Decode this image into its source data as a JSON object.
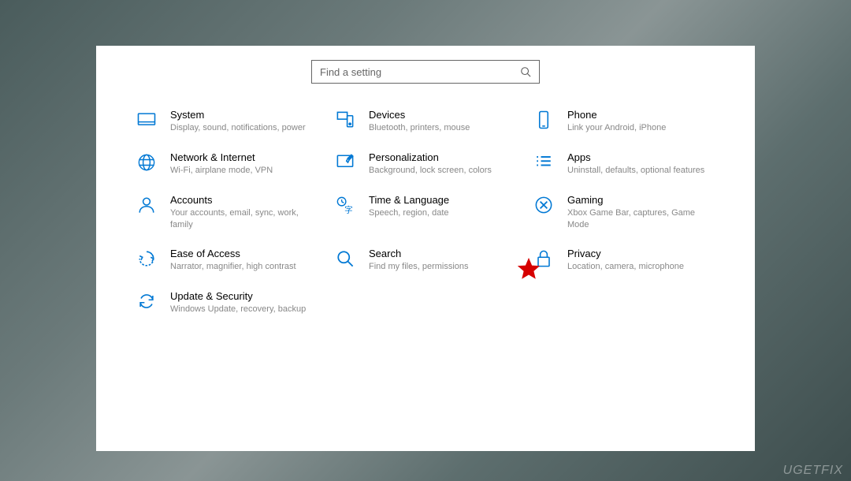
{
  "search": {
    "placeholder": "Find a setting"
  },
  "categories": [
    {
      "id": "system",
      "title": "System",
      "subtitle": "Display, sound, notifications, power"
    },
    {
      "id": "devices",
      "title": "Devices",
      "subtitle": "Bluetooth, printers, mouse"
    },
    {
      "id": "phone",
      "title": "Phone",
      "subtitle": "Link your Android, iPhone"
    },
    {
      "id": "network",
      "title": "Network & Internet",
      "subtitle": "Wi-Fi, airplane mode, VPN"
    },
    {
      "id": "personalization",
      "title": "Personalization",
      "subtitle": "Background, lock screen, colors"
    },
    {
      "id": "apps",
      "title": "Apps",
      "subtitle": "Uninstall, defaults, optional features"
    },
    {
      "id": "accounts",
      "title": "Accounts",
      "subtitle": "Your accounts, email, sync, work, family"
    },
    {
      "id": "time",
      "title": "Time & Language",
      "subtitle": "Speech, region, date"
    },
    {
      "id": "gaming",
      "title": "Gaming",
      "subtitle": "Xbox Game Bar, captures, Game Mode"
    },
    {
      "id": "ease",
      "title": "Ease of Access",
      "subtitle": "Narrator, magnifier, high contrast"
    },
    {
      "id": "searchcat",
      "title": "Search",
      "subtitle": "Find my files, permissions"
    },
    {
      "id": "privacy",
      "title": "Privacy",
      "subtitle": "Location, camera, microphone"
    },
    {
      "id": "update",
      "title": "Update & Security",
      "subtitle": "Windows Update, recovery, backup"
    }
  ],
  "accentColor": "#0078d4",
  "highlightMarker": {
    "target": "privacy"
  },
  "watermark": "UGETFIX"
}
